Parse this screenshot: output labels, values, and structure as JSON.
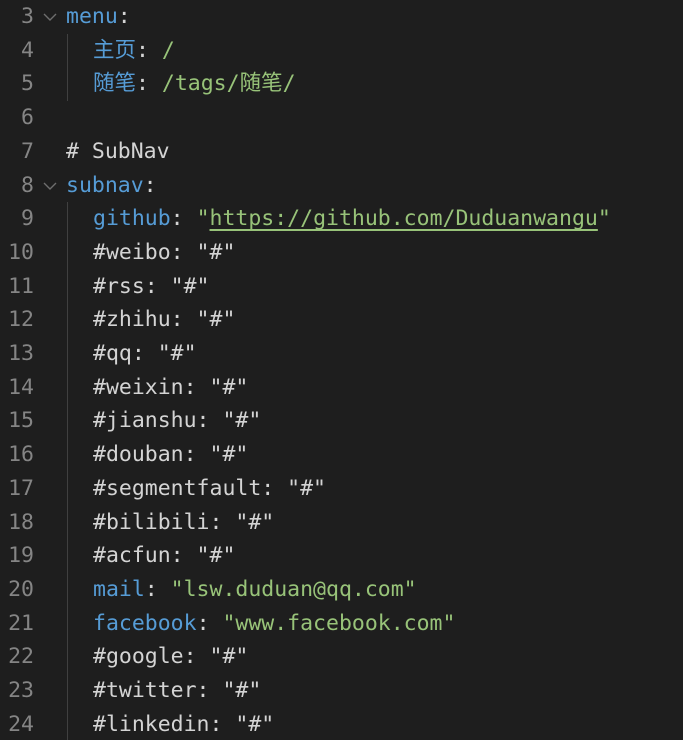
{
  "lines": [
    {
      "n": "3",
      "fold": true,
      "indent": 0,
      "parts": [
        {
          "t": "menu",
          "c": "key"
        },
        {
          "t": ":",
          "c": "plain"
        }
      ]
    },
    {
      "n": "4",
      "fold": false,
      "indent": 1,
      "parts": [
        {
          "t": "主页",
          "c": "key"
        },
        {
          "t": ": ",
          "c": "plain"
        },
        {
          "t": "/",
          "c": "green"
        }
      ]
    },
    {
      "n": "5",
      "fold": false,
      "indent": 1,
      "parts": [
        {
          "t": "随笔",
          "c": "key"
        },
        {
          "t": ": ",
          "c": "plain"
        },
        {
          "t": "/tags/随笔/",
          "c": "green"
        }
      ]
    },
    {
      "n": "6",
      "fold": false,
      "indent": 0,
      "parts": []
    },
    {
      "n": "7",
      "fold": false,
      "indent": 0,
      "parts": [
        {
          "t": "# SubNav",
          "c": "plain"
        }
      ]
    },
    {
      "n": "8",
      "fold": true,
      "indent": 0,
      "parts": [
        {
          "t": "subnav",
          "c": "key"
        },
        {
          "t": ":",
          "c": "plain"
        }
      ]
    },
    {
      "n": "9",
      "fold": false,
      "indent": 1,
      "parts": [
        {
          "t": "github",
          "c": "key"
        },
        {
          "t": ": ",
          "c": "plain"
        },
        {
          "t": "\"",
          "c": "green"
        },
        {
          "t": "https://github.com/Duduanwangu",
          "c": "url"
        },
        {
          "t": "\"",
          "c": "green"
        }
      ]
    },
    {
      "n": "10",
      "fold": false,
      "indent": 1,
      "parts": [
        {
          "t": "#weibo: \"#\"",
          "c": "plain"
        }
      ]
    },
    {
      "n": "11",
      "fold": false,
      "indent": 1,
      "parts": [
        {
          "t": "#rss: \"#\"",
          "c": "plain"
        }
      ]
    },
    {
      "n": "12",
      "fold": false,
      "indent": 1,
      "parts": [
        {
          "t": "#zhihu: \"#\"",
          "c": "plain"
        }
      ]
    },
    {
      "n": "13",
      "fold": false,
      "indent": 1,
      "parts": [
        {
          "t": "#qq: \"#\"",
          "c": "plain"
        }
      ]
    },
    {
      "n": "14",
      "fold": false,
      "indent": 1,
      "parts": [
        {
          "t": "#weixin: \"#\"",
          "c": "plain"
        }
      ]
    },
    {
      "n": "15",
      "fold": false,
      "indent": 1,
      "parts": [
        {
          "t": "#jianshu: \"#\"",
          "c": "plain"
        }
      ]
    },
    {
      "n": "16",
      "fold": false,
      "indent": 1,
      "parts": [
        {
          "t": "#douban: \"#\"",
          "c": "plain"
        }
      ]
    },
    {
      "n": "17",
      "fold": false,
      "indent": 1,
      "parts": [
        {
          "t": "#segmentfault: \"#\"",
          "c": "plain"
        }
      ]
    },
    {
      "n": "18",
      "fold": false,
      "indent": 1,
      "parts": [
        {
          "t": "#bilibili: \"#\"",
          "c": "plain"
        }
      ]
    },
    {
      "n": "19",
      "fold": false,
      "indent": 1,
      "parts": [
        {
          "t": "#acfun: \"#\"",
          "c": "plain"
        }
      ]
    },
    {
      "n": "20",
      "fold": false,
      "indent": 1,
      "parts": [
        {
          "t": "mail",
          "c": "key"
        },
        {
          "t": ": ",
          "c": "plain"
        },
        {
          "t": "\"lsw.duduan@qq.com\"",
          "c": "green"
        }
      ]
    },
    {
      "n": "21",
      "fold": false,
      "indent": 1,
      "parts": [
        {
          "t": "facebook",
          "c": "key"
        },
        {
          "t": ": ",
          "c": "plain"
        },
        {
          "t": "\"www.facebook.com\"",
          "c": "green"
        }
      ]
    },
    {
      "n": "22",
      "fold": false,
      "indent": 1,
      "parts": [
        {
          "t": "#google: \"#\"",
          "c": "plain"
        }
      ]
    },
    {
      "n": "23",
      "fold": false,
      "indent": 1,
      "parts": [
        {
          "t": "#twitter: \"#\"",
          "c": "plain"
        }
      ]
    },
    {
      "n": "24",
      "fold": false,
      "indent": 1,
      "parts": [
        {
          "t": "#linkedin: \"#\"",
          "c": "plain"
        }
      ]
    }
  ],
  "colors": {
    "background": "#1e1e1e",
    "line_number": "#858585",
    "key": "#569cd6",
    "string": "#98c379",
    "text": "#d4d4d4"
  }
}
